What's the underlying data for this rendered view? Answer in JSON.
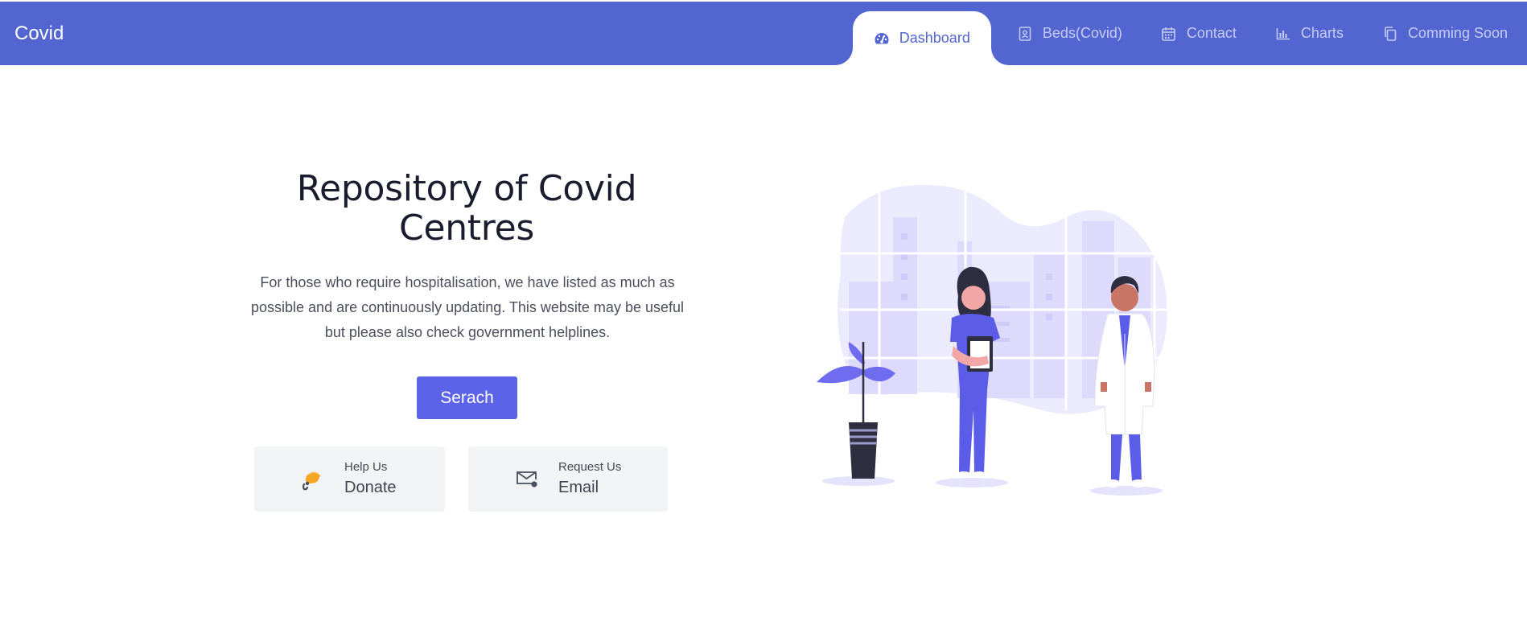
{
  "navbar": {
    "brand": "Covid",
    "tabs": [
      {
        "label": "Dashboard",
        "icon": "dashboard-gauge-icon",
        "active": true
      },
      {
        "label": "Beds(Covid)",
        "icon": "contact-book-icon",
        "active": false
      },
      {
        "label": "Contact",
        "icon": "calendar-icon",
        "active": false
      },
      {
        "label": "Charts",
        "icon": "bar-chart-icon",
        "active": false
      },
      {
        "label": "Comming Soon",
        "icon": "copy-pages-icon",
        "active": false
      }
    ]
  },
  "hero": {
    "title": "Repository of Covid Centres",
    "description": "For those who require hospitalisation, we have listed as much as possible and are continuously updating. This website may be useful but please also check government helplines.",
    "search_label": "Serach"
  },
  "cards": {
    "donate": {
      "small": "Help Us",
      "big": "Donate",
      "icon": "piggy-coin-icon"
    },
    "email": {
      "small": "Request Us",
      "big": "Email",
      "icon": "mail-icon"
    }
  },
  "colors": {
    "navbar": "#5265d1",
    "accent": "#5b63e8",
    "illustration_bg": "#eceafd",
    "scrub_purple": "#5b5de8"
  }
}
